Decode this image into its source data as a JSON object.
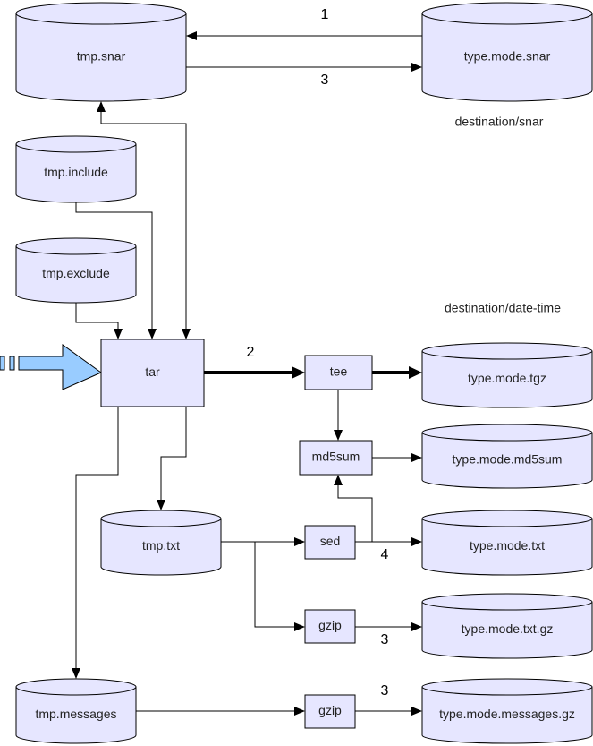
{
  "nodes": {
    "tmp_snar": "tmp.snar",
    "type_mode_snar": "type.mode.snar",
    "tmp_include": "tmp.include",
    "tmp_exclude": "tmp.exclude",
    "tar": "tar",
    "tee": "tee",
    "type_mode_tgz": "type.mode.tgz",
    "md5sum": "md5sum",
    "type_mode_md5sum": "type.mode.md5sum",
    "tmp_txt": "tmp.txt",
    "sed": "sed",
    "type_mode_txt": "type.mode.txt",
    "gzip_txt": "gzip",
    "type_mode_txt_gz": "type.mode.txt.gz",
    "tmp_messages": "tmp.messages",
    "gzip_messages": "gzip",
    "type_mode_messages_gz": "type.mode.messages.gz"
  },
  "labels": {
    "destination_snar": "destination/snar",
    "destination_date_time": "destination/date-time",
    "step_1": "1",
    "step_3_snar": "3",
    "step_2": "2",
    "step_4": "4",
    "step_3_txt_gz": "3",
    "step_3_messages": "3"
  },
  "colors": {
    "node_fill": "#e6e6ff",
    "input_arrow": "#99ccff"
  }
}
